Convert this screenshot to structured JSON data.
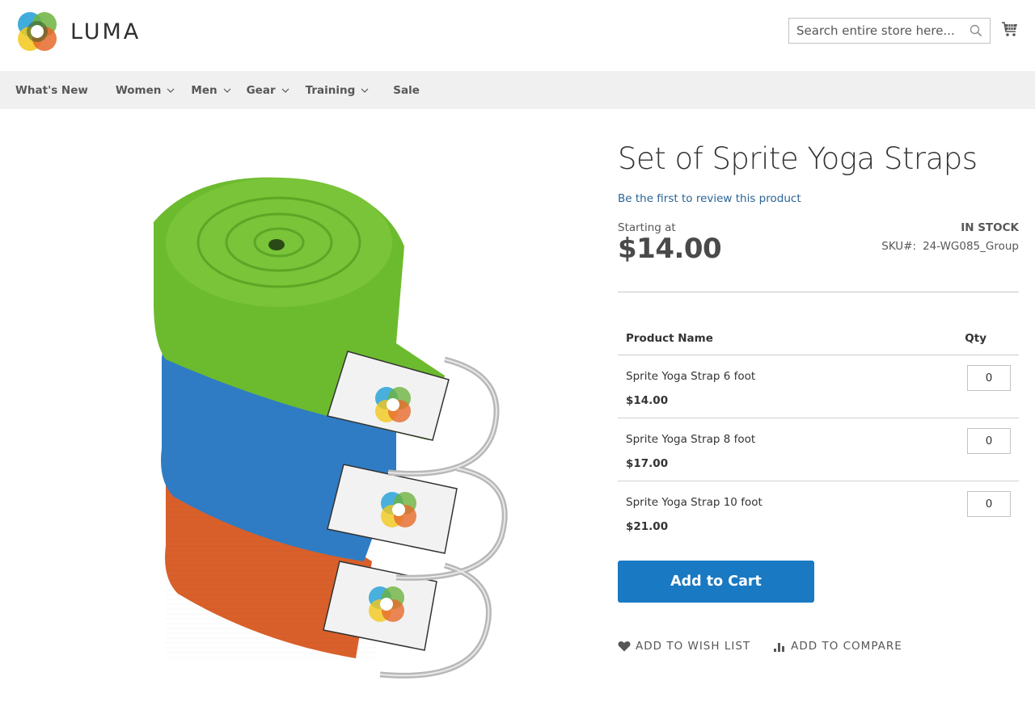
{
  "header": {
    "logo_text": "LUMA",
    "search_placeholder": "Search entire store here...",
    "search_icon": "search-icon",
    "cart_icon": "shopping-cart-icon"
  },
  "nav": {
    "items": [
      {
        "label": "What's New",
        "has_dropdown": false
      },
      {
        "label": "Women",
        "has_dropdown": true
      },
      {
        "label": "Men",
        "has_dropdown": true
      },
      {
        "label": "Gear",
        "has_dropdown": true
      },
      {
        "label": "Training",
        "has_dropdown": true
      },
      {
        "label": "Sale",
        "has_dropdown": false
      }
    ]
  },
  "product": {
    "title": "Set of Sprite Yoga Straps",
    "review_link": "Be the first to review this product",
    "starting_at_label": "Starting at",
    "price": "$14.00",
    "stock_status": "IN STOCK",
    "sku_label": "SKU#:",
    "sku_value": "24-WG085_Group",
    "image_alt": "Set of three rolled yoga straps in green, blue and orange with metal D-rings",
    "strap_colors": [
      "#6cbb2e",
      "#2f7cc4",
      "#d9602a"
    ]
  },
  "grouped_table": {
    "headers": {
      "name": "Product Name",
      "qty": "Qty"
    },
    "rows": [
      {
        "name": "Sprite Yoga Strap 6 foot",
        "price": "$14.00",
        "qty": "0"
      },
      {
        "name": "Sprite Yoga Strap 8 foot",
        "price": "$17.00",
        "qty": "0"
      },
      {
        "name": "Sprite Yoga Strap 10 foot",
        "price": "$21.00",
        "qty": "0"
      }
    ]
  },
  "actions": {
    "add_to_cart": "Add to Cart",
    "add_to_wishlist": "ADD TO WISH LIST",
    "add_to_compare": "ADD TO COMPARE"
  },
  "colors": {
    "primary_button": "#1979c3",
    "link": "#2a6496",
    "nav_bg": "#f0f0f0"
  }
}
